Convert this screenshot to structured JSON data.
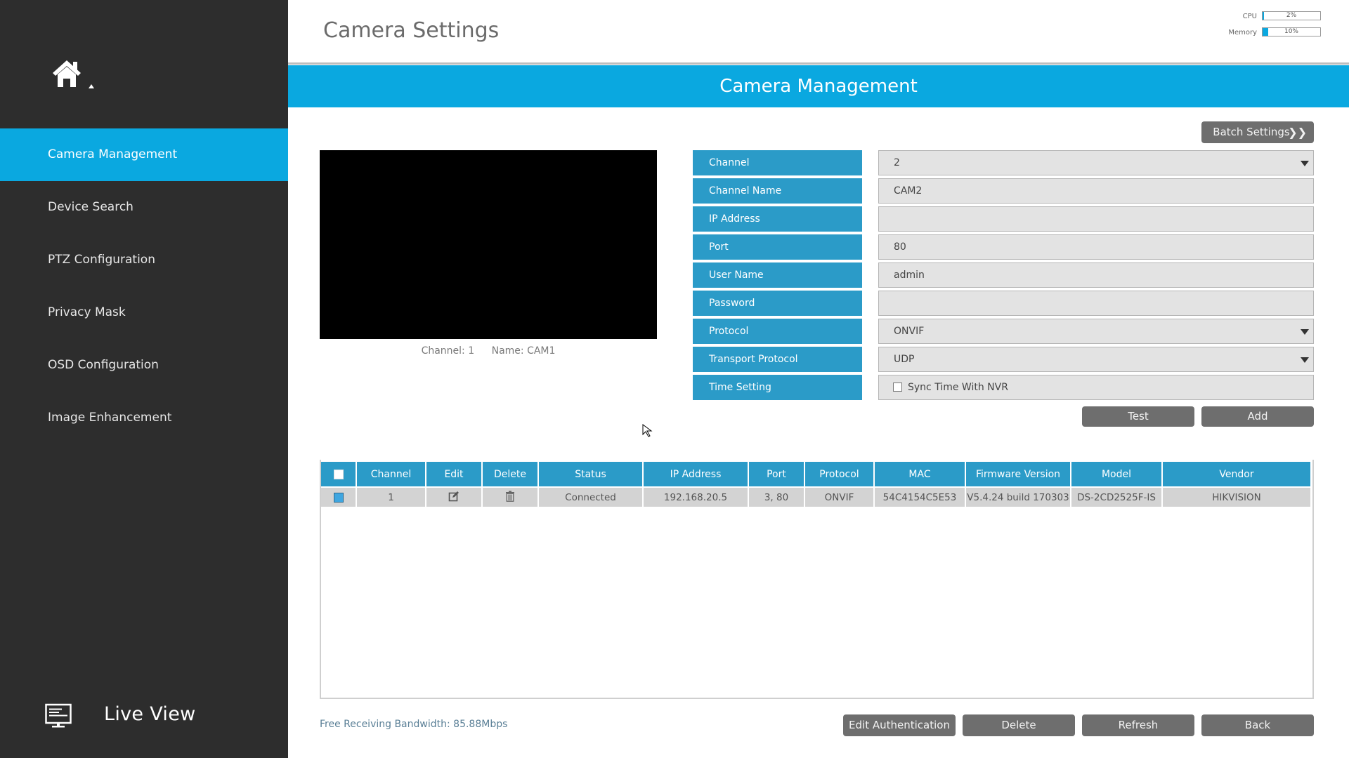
{
  "app": {
    "title": "Camera Settings"
  },
  "system": {
    "cpu_label": "CPU",
    "cpu_value": "2%",
    "cpu_fraction": 0.02,
    "memory_label": "Memory",
    "memory_value": "10%",
    "memory_fraction": 0.1
  },
  "sidebar": {
    "home_icon": "home-icon",
    "items": [
      {
        "label": "Camera Management",
        "active": true
      },
      {
        "label": "Device Search",
        "active": false
      },
      {
        "label": "PTZ Configuration",
        "active": false
      },
      {
        "label": "Privacy Mask",
        "active": false
      },
      {
        "label": "OSD Configuration",
        "active": false
      },
      {
        "label": "Image Enhancement",
        "active": false
      }
    ],
    "live_view": {
      "label": "Live View",
      "icon": "monitor-icon"
    }
  },
  "banner": {
    "title": "Camera Management"
  },
  "toolbar": {
    "batch_settings": "Batch Settings",
    "batch_icon": "double-chevron-right-icon"
  },
  "preview": {
    "channel_caption": "Channel: 1",
    "name_caption": "Name: CAM1"
  },
  "form": {
    "fields": [
      {
        "label": "Channel",
        "value": "2",
        "type": "select"
      },
      {
        "label": "Channel Name",
        "value": "CAM2",
        "type": "text"
      },
      {
        "label": "IP Address",
        "value": "",
        "type": "text"
      },
      {
        "label": "Port",
        "value": "80",
        "type": "text"
      },
      {
        "label": "User Name",
        "value": "admin",
        "type": "text"
      },
      {
        "label": "Password",
        "value": "",
        "type": "password"
      },
      {
        "label": "Protocol",
        "value": "ONVIF",
        "type": "select"
      },
      {
        "label": "Transport Protocol",
        "value": "UDP",
        "type": "select"
      },
      {
        "label": "Time Setting",
        "value": "Sync Time With NVR",
        "type": "checkbox",
        "checked": false
      }
    ],
    "test_label": "Test",
    "add_label": "Add"
  },
  "table": {
    "columns": [
      "",
      "Channel",
      "Edit",
      "Delete",
      "Status",
      "IP Address",
      "Port",
      "Protocol",
      "MAC",
      "Firmware Version",
      "Model",
      "Vendor"
    ],
    "rows": [
      {
        "selected": true,
        "channel": "1",
        "edit_icon": "edit-icon",
        "delete_icon": "trash-icon",
        "status": "Connected",
        "ip": "192.168.20.5",
        "port": "3, 80",
        "protocol": "ONVIF",
        "mac": "54C4154C5E53",
        "firmware": "V5.4.24 build 170303",
        "model": "DS-2CD2525F-IS",
        "vendor": "HIKVISION"
      }
    ]
  },
  "footer": {
    "bandwidth": "Free Receiving Bandwidth: 85.88Mbps",
    "edit_auth": "Edit Authentication",
    "delete": "Delete",
    "refresh": "Refresh",
    "back": "Back"
  },
  "colors": {
    "accent": "#0aa8e0",
    "label_blue": "#2b9bc8",
    "sidebar_bg": "#2d2d2d",
    "button_gray": "#6e6e6e"
  }
}
